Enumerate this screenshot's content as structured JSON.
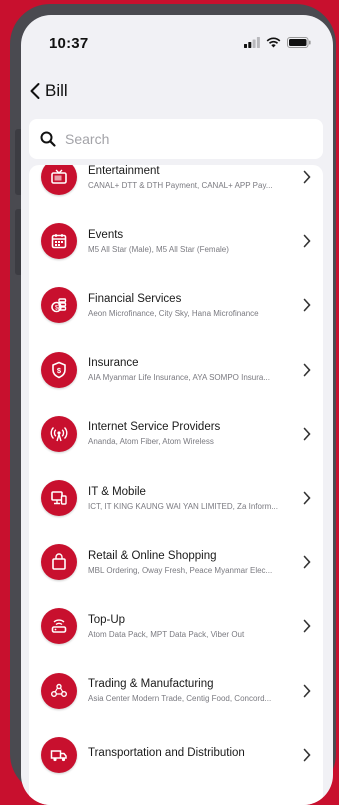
{
  "status": {
    "time": "10:37"
  },
  "header": {
    "back_label": "Bill"
  },
  "search": {
    "placeholder": "Search"
  },
  "categories": [
    {
      "name": "Entertainment",
      "desc": "CANAL+ DTT & DTH Payment, CANAL+ APP Pay...",
      "icon": "tv-icon"
    },
    {
      "name": "Events",
      "desc": "M5 All Star (Male), M5 All Star (Female)",
      "icon": "calendar-icon"
    },
    {
      "name": "Financial Services",
      "desc": "Aeon Microfinance, City Sky, Hana Microfinance",
      "icon": "coins-icon"
    },
    {
      "name": "Insurance",
      "desc": "AIA Myanmar Life Insurance, AYA SOMPO Insura...",
      "icon": "shield-dollar-icon"
    },
    {
      "name": "Internet Service Providers",
      "desc": "Ananda, Atom Fiber, Atom Wireless",
      "icon": "antenna-icon"
    },
    {
      "name": "IT & Mobile",
      "desc": "ICT, IT KING KAUNG WAI YAN LIMITED, Za Inform...",
      "icon": "devices-icon"
    },
    {
      "name": "Retail & Online Shopping",
      "desc": "MBL Ordering, Oway Fresh, Peace Myanmar Elec...",
      "icon": "shopping-bag-icon"
    },
    {
      "name": "Top-Up",
      "desc": "Atom Data Pack, MPT Data Pack, Viber Out",
      "icon": "router-icon"
    },
    {
      "name": "Trading & Manufacturing",
      "desc": "Asia Center Modern Trade, Centig Food, Concord...",
      "icon": "people-network-icon"
    },
    {
      "name": "Transportation and Distribution",
      "desc": "",
      "icon": "truck-icon"
    }
  ]
}
